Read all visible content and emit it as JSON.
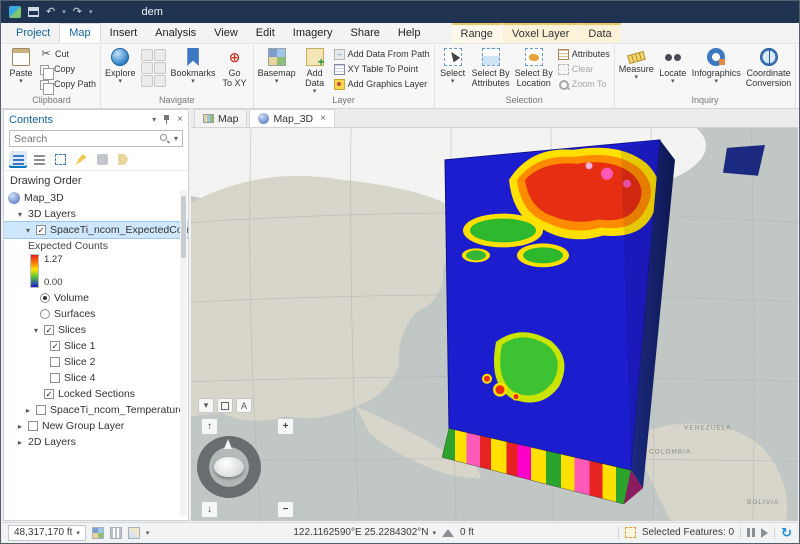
{
  "colors": {
    "titlebar": "#203452",
    "accent": "#0079c1",
    "selection_highlight": "#cfe7fb",
    "contextual_tab": "#fbf2d8"
  },
  "icons": {
    "caret_down": "▾",
    "caret_right": "▸",
    "close": "×",
    "check": "✓",
    "up": "↑",
    "down": "↓",
    "plus": "+",
    "minus": "−",
    "undo": "↶",
    "redo": "↷",
    "cut_glyph": "✂",
    "target": "⊕",
    "refresh": "↻"
  },
  "titlebar": {
    "title": "dem"
  },
  "menu": {
    "tabs": [
      "Project",
      "Map",
      "Insert",
      "Analysis",
      "View",
      "Edit",
      "Imagery",
      "Share",
      "Help"
    ],
    "contextual": [
      "Range",
      "Voxel Layer",
      "Data"
    ]
  },
  "ribbon": {
    "clipboard": {
      "label": "Clipboard",
      "paste": "Paste",
      "cut": "Cut",
      "copy": "Copy",
      "copy_path": "Copy Path"
    },
    "navigate": {
      "label": "Navigate",
      "explore": "Explore",
      "bookmarks": "Bookmarks",
      "goto": "Go\nTo XY"
    },
    "layer": {
      "label": "Layer",
      "basemap": "Basemap",
      "add_data": "Add\nData",
      "from_path": "Add Data From Path",
      "xy_table": "XY Table To Point",
      "graphics": "Add Graphics Layer"
    },
    "selection": {
      "label": "Selection",
      "select": "Select",
      "by_attributes": "Select By\nAttributes",
      "by_location": "Select By\nLocation",
      "attributes": "Attributes",
      "clear": "Clear",
      "zoom_to": "Zoom To"
    },
    "inquiry": {
      "label": "Inquiry",
      "measure": "Measure",
      "locate": "Locate",
      "infographics": "Infographics",
      "coordinate": "Coordinate\nConversion"
    }
  },
  "contents": {
    "title": "Contents",
    "search_placeholder": "Search",
    "drawing_order": "Drawing Order",
    "map3d": "Map_3D",
    "layers3d": "3D Layers",
    "expected_counts_layer": "SpaceTi_ncom_ExpectedCounts",
    "legend_title": "Expected Counts",
    "legend_max": "1.27",
    "legend_min": "0.00",
    "volume": "Volume",
    "surfaces": "Surfaces",
    "slices": "Slices",
    "slice1": "Slice 1",
    "slice2": "Slice 2",
    "slice4": "Slice 4",
    "locked_sections": "Locked Sections",
    "temperature_layer": "SpaceTi_ncom_Temperature",
    "new_group_layer": "New Group Layer",
    "layers2d": "2D Layers"
  },
  "map": {
    "tabs": [
      "Map",
      "Map_3D"
    ],
    "overlay_a": "A",
    "labels": [
      "VENEZUELA",
      "COLOMBIA",
      "BOLIVIA"
    ]
  },
  "voxel": {
    "top_color": "#1d1dd0",
    "side_color": "#16246e",
    "palette": [
      "#1d1dd0",
      "#2db82d",
      "#ffe400",
      "#ff8c00",
      "#e62e12",
      "#ff59b9",
      "#ff00c8"
    ]
  },
  "statusbar": {
    "scale": "48,317,170 ft",
    "coords": "122.1162590°E 25.2284302°N",
    "elevation": "0 ft",
    "selected": "Selected Features: 0"
  }
}
